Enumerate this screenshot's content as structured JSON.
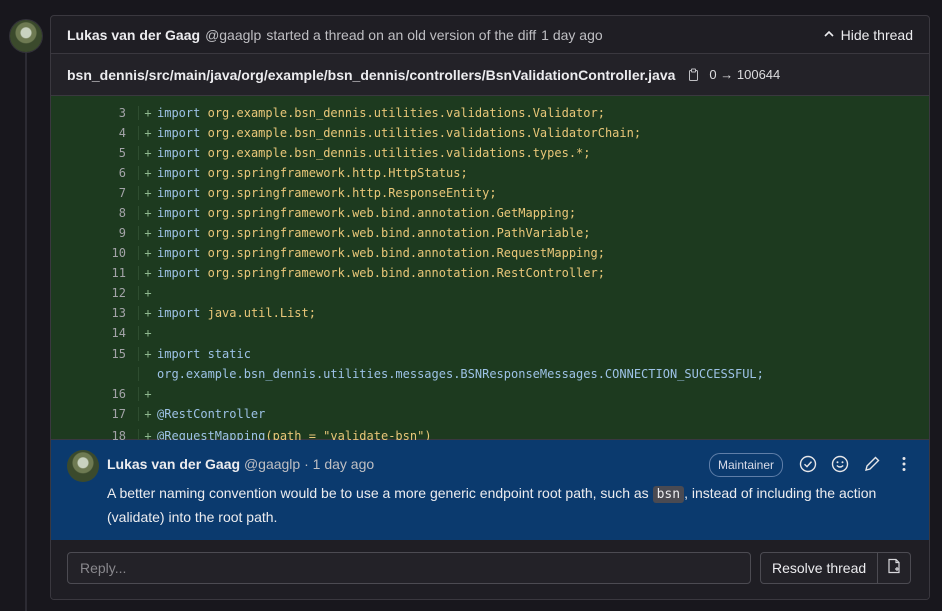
{
  "thread": {
    "author_name": "Lukas van der Gaag",
    "author_handle": "@gaaglp",
    "action_text": "started a thread on an old version of the diff",
    "time": "1 day ago",
    "hide_label": "Hide thread"
  },
  "file": {
    "path": "bsn_dennis/src/main/java/org/example/bsn_dennis/controllers/BsnValidationController.java",
    "mode": "0 → 100644"
  },
  "code_lines": [
    {
      "num": "3",
      "kw": "import",
      "rest": "org.example.bsn_dennis.utilities.validations.Validator;"
    },
    {
      "num": "4",
      "kw": "import",
      "rest": "org.example.bsn_dennis.utilities.validations.ValidatorChain;"
    },
    {
      "num": "5",
      "kw": "import",
      "rest": "org.example.bsn_dennis.utilities.validations.types.*;"
    },
    {
      "num": "6",
      "kw": "import",
      "rest": "org.springframework.http.HttpStatus;"
    },
    {
      "num": "7",
      "kw": "import",
      "rest": "org.springframework.http.ResponseEntity;"
    },
    {
      "num": "8",
      "kw": "import",
      "rest": "org.springframework.web.bind.annotation.GetMapping;"
    },
    {
      "num": "9",
      "kw": "import",
      "rest": "org.springframework.web.bind.annotation.PathVariable;"
    },
    {
      "num": "10",
      "kw": "import",
      "rest": "org.springframework.web.bind.annotation.RequestMapping;"
    },
    {
      "num": "11",
      "kw": "import",
      "rest": "org.springframework.web.bind.annotation.RestController;"
    },
    {
      "num": "12",
      "kw": "",
      "rest": ""
    },
    {
      "num": "13",
      "kw": "import",
      "rest": "java.util.List;"
    },
    {
      "num": "14",
      "kw": "",
      "rest": ""
    },
    {
      "num": "15",
      "kw": "import static",
      "rest": ""
    },
    {
      "num": "",
      "kw": "",
      "rest": "org.example.bsn_dennis.utilities.messages.BSNResponseMessages.CONNECTION_SUCCESSFUL;"
    },
    {
      "num": "16",
      "kw": "",
      "rest": ""
    },
    {
      "num": "17",
      "kw": "@RestController",
      "rest": ""
    },
    {
      "num": "18",
      "kw": "@RequestMapping",
      "rest": "(path = \"validate-bsn\")"
    }
  ],
  "note": {
    "author_name": "Lukas van der Gaag",
    "author_handle": "@gaaglp",
    "time": "· 1 day ago",
    "badge": "Maintainer",
    "body_before": "A better naming convention would be to use a more generic endpoint root path, such as",
    "inline_code": "bsn",
    "body_after": ", instead of including the action (validate) into the root path."
  },
  "reply": {
    "placeholder": "Reply...",
    "resolve_label": "Resolve thread"
  },
  "colors": {
    "added_background": "#1d3a1f",
    "note_background": "#0b3a6e"
  }
}
